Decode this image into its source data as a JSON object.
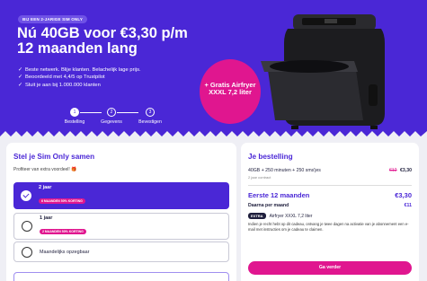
{
  "hero": {
    "badge": "BIJ EEN 2-JARIGE SIM ONLY",
    "headline_line1": "Nú 40GB voor €3,30 p/m",
    "headline_line2": "12 maanden lang",
    "bullets": [
      "Beste netwerk. Blije klanten. Belachelijk lage prijs.",
      "Beoordeeld met 4,4/5 op Trustpilot",
      "Sluit je aan bij 1.000.000 klanten"
    ],
    "steps": [
      {
        "num": "1",
        "label": "Bestelling"
      },
      {
        "num": "2",
        "label": "Gegevens"
      },
      {
        "num": "3",
        "label": "Bevestigen"
      }
    ],
    "promo_line1": "+ Gratis Airfryer",
    "promo_line2": "XXXL 7,2 liter"
  },
  "left": {
    "title": "Stel je Sim Only samen",
    "subtitle": "Profiteer van extra voordeel!",
    "options": [
      {
        "title": "2 jaar",
        "pill": "6 MAANDEN 50% KORTING"
      },
      {
        "title": "1 jaar",
        "pill": "2 MAANDEN 50% KORTING"
      },
      {
        "title": "Maandelijks opzegbaar"
      }
    ]
  },
  "right": {
    "title": "Je bestelling",
    "bundle": "40GB + 250 minuten + 250 sms'jes",
    "old_price": "€12",
    "new_price": "€3,30",
    "bundle_sub": "2 jaar contract",
    "first_months_label": "Eerste 12 maanden",
    "first_months_price": "€3,30",
    "after_label": "Daarna per maand",
    "after_price": "€11",
    "extra_badge": "EXTRA",
    "extra_item": "Airfryer XXXL 7,2 liter",
    "note": "Indien je recht hebt op dit cadeau, ontvang je twee dagen na activatie van je abonnement een e-mail met instructies om je cadeau te claimen.",
    "cta": "Ga verder"
  },
  "colors": {
    "brand_purple": "#4a27d6",
    "brand_pink": "#e0168f"
  }
}
